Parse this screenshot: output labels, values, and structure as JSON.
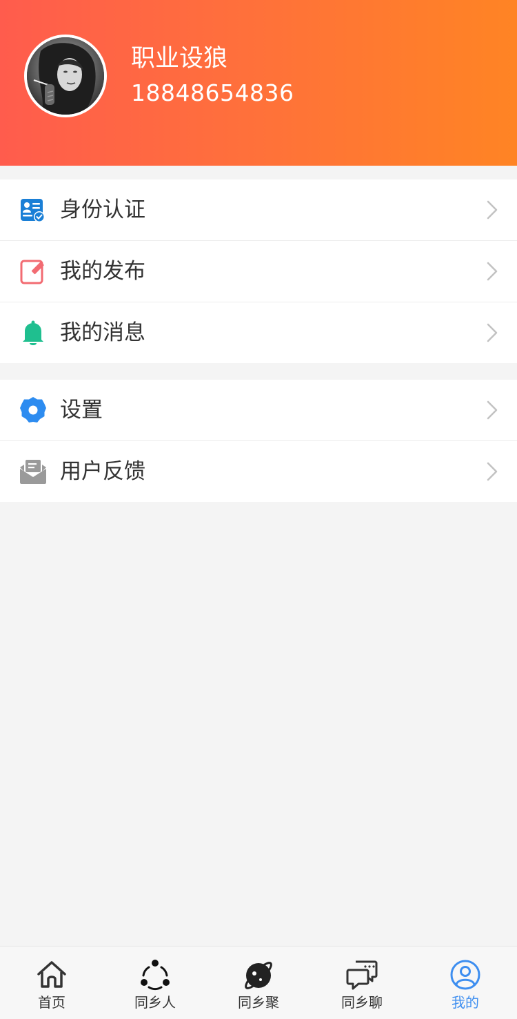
{
  "profile": {
    "username": "职业设狼",
    "phone": "18848654836"
  },
  "menu_group_1": [
    {
      "label": "身份认证",
      "icon": "id-card-icon",
      "color": "#1a7fd6"
    },
    {
      "label": "我的发布",
      "icon": "edit-icon",
      "color": "#f26b72"
    },
    {
      "label": "我的消息",
      "icon": "bell-icon",
      "color": "#1fbf8f"
    }
  ],
  "menu_group_2": [
    {
      "label": "设置",
      "icon": "gear-icon",
      "color": "#2d8cf0"
    },
    {
      "label": "用户反馈",
      "icon": "mail-icon",
      "color": "#9a9a9a"
    }
  ],
  "tabbar": {
    "items": [
      {
        "label": "首页",
        "icon": "home-icon"
      },
      {
        "label": "同乡人",
        "icon": "people-icon"
      },
      {
        "label": "同乡聚",
        "icon": "planet-icon"
      },
      {
        "label": "同乡聊",
        "icon": "chat-icon"
      },
      {
        "label": "我的",
        "icon": "user-icon",
        "active": true
      }
    ],
    "active_color": "#3d8ef0"
  },
  "colors": {
    "header_start": "#ff5c4d",
    "header_end": "#ff8424",
    "background": "#f4f4f4"
  }
}
